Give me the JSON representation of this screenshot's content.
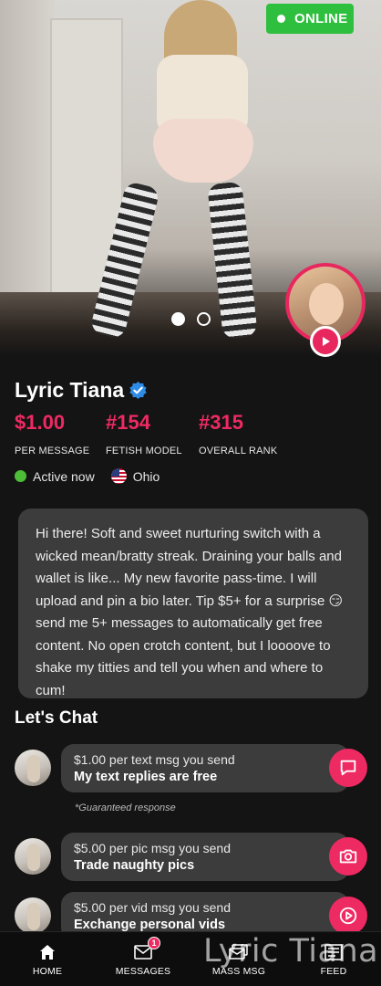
{
  "status_badge": "ONLINE",
  "profile": {
    "name": "Lyric Tiana",
    "stats": [
      {
        "value": "$1.00",
        "label": "PER MESSAGE"
      },
      {
        "value": "#154",
        "label": "FETISH MODEL"
      },
      {
        "value": "#315",
        "label": "OVERALL RANK"
      }
    ],
    "activity": "Active now",
    "location": "Ohio",
    "bio": "Hi there! Soft and sweet nurturing switch with a wicked mean/bratty streak. Draining your balls and wallet is like... My new favorite pass-time. I will upload and pin a bio later. Tip $5+ for a surprise 😏 send me 5+ messages to automatically get free content. No open crotch content, but I loooove to shake my titties and tell you when and where to cum!"
  },
  "chat": {
    "title": "Let's Chat",
    "options": [
      {
        "price": "$1.00 per text msg you send",
        "desc": "My text replies are free",
        "icon": "chat-icon"
      },
      {
        "price": "$5.00 per pic msg you send",
        "desc": "Trade naughty pics",
        "icon": "camera-icon"
      },
      {
        "price": "$5.00 per vid msg you send",
        "desc": "Exchange personal vids",
        "icon": "play-icon"
      }
    ],
    "guarantee": "*Guaranteed response"
  },
  "nav": {
    "items": [
      {
        "label": "HOME",
        "icon": "home-icon"
      },
      {
        "label": "MESSAGES",
        "icon": "envelope-icon",
        "badge": "1"
      },
      {
        "label": "MASS MSG",
        "icon": "mass-message-icon"
      },
      {
        "label": "FEED",
        "icon": "feed-icon"
      }
    ]
  },
  "watermark": "Lyric Tiana",
  "colors": {
    "accent": "#ee2a63",
    "online": "#2fbf3f",
    "active": "#4cbe37",
    "background": "#141414",
    "bubble": "#3c3c3c"
  }
}
